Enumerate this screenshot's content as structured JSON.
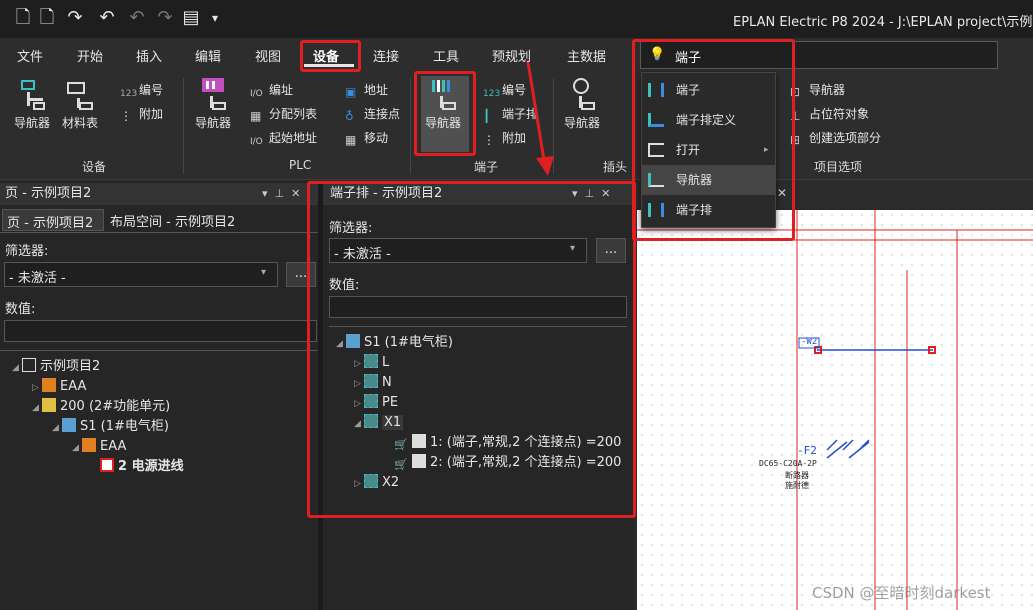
{
  "title": "EPLAN Electric P8 2024 - J:\\EPLAN project\\示例",
  "menu": [
    "文件",
    "开始",
    "插入",
    "编辑",
    "视图",
    "设备",
    "连接",
    "工具",
    "预规划",
    "主数据"
  ],
  "search": {
    "value": "端子"
  },
  "search_results": [
    "端子",
    "端子排定义",
    "打开",
    "导航器",
    "端子排"
  ],
  "ribbon": {
    "device": {
      "nav": "导航器",
      "parts": "材料表",
      "numbering": "编号",
      "attach": "附加",
      "group": "设备"
    },
    "plc": {
      "nav": "导航器",
      "edit": "编址",
      "alloc": "分配列表",
      "start": "起始地址",
      "addr": "地址",
      "conn": "连接点",
      "move": "移动",
      "group": "PLC"
    },
    "terminal": {
      "nav": "导航器",
      "numbering": "编号",
      "strip": "端子排",
      "attach": "附加",
      "group": "端子"
    },
    "plug": {
      "nav": "导航器",
      "group": "插头"
    },
    "project_options": {
      "nav": "导航器",
      "placeholder": "占位符对象",
      "create": "创建选项部分",
      "group": "项目选项"
    }
  },
  "page_panel": {
    "title": "页 - 示例项目2",
    "tabs": [
      "页 - 示例项目2",
      "布局空间 - 示例项目2"
    ],
    "filter_label": "筛选器:",
    "filter_value": "- 未激活 -",
    "more": "...",
    "value_label": "数值:",
    "tree": [
      "示例项目2",
      "EAA",
      "200 (2#功能单元)",
      "S1 (1#电气柜)",
      "EAA",
      "2 电源进线"
    ]
  },
  "terminal_panel": {
    "title": "端子排 - 示例项目2",
    "filter_label": "筛选器:",
    "filter_value": "- 未激活 -",
    "more": "...",
    "value_label": "数值:",
    "tree": [
      "S1 (1#电气柜)",
      "L",
      "N",
      "PE",
      "X1",
      "1: (端子,常规,2 个连接点) =200",
      "2: (端子,常规,2 个连接点) =200",
      "X2"
    ]
  },
  "drawing": {
    "w2": "-W2",
    "f2": "-F2",
    "part": "DC65-C20A-2P",
    "t1": "断路器",
    "t2": "施耐德"
  },
  "watermark": "CSDN @至暗时刻darkest",
  "colors": {
    "accent": "#e02020",
    "teal": "#3cc0c0"
  }
}
